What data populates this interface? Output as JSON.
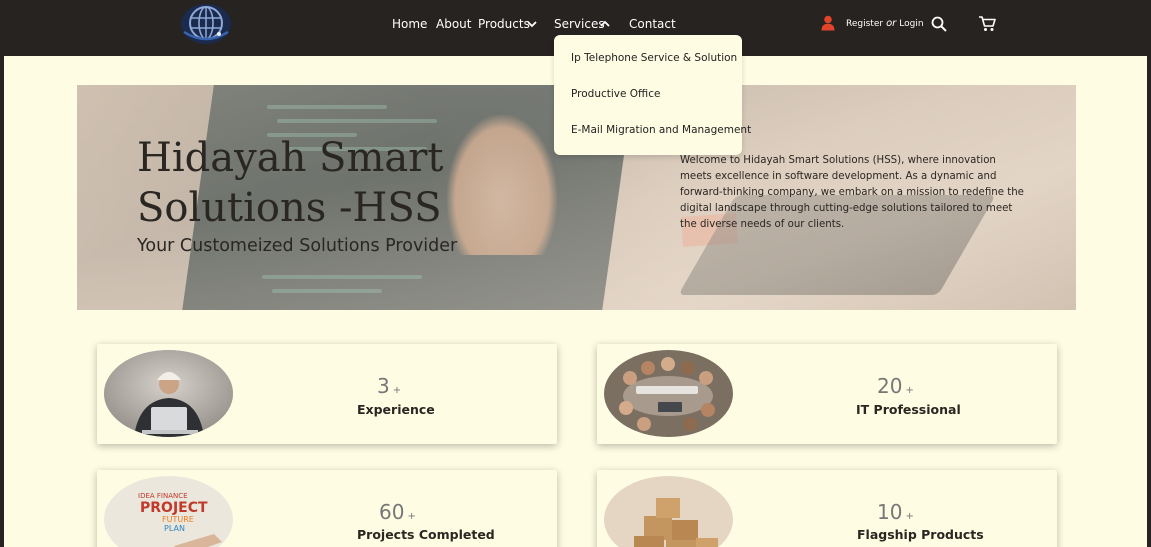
{
  "nav": {
    "home": "Home",
    "about": "About",
    "products": "Products",
    "services": "Services",
    "contact": "Contact",
    "register": "Register",
    "or": "or",
    "login": "Login"
  },
  "services_menu": {
    "items": [
      "Ip Telephone Service & Solution",
      "Productive Office",
      "E-Mail Migration and Management"
    ]
  },
  "hero": {
    "title": "Hidayah Smart Solutions -HSS",
    "subtitle": "Your Customeized Solutions Provider",
    "description": "Welcome to Hidayah Smart Solutions (HSS), where innovation meets excellence in software development. As a dynamic and forward-thinking company, we embark on a mission to redefine the digital landscape through cutting-edge solutions tailored to meet the diverse needs of our clients."
  },
  "stats": [
    {
      "value": "3",
      "plus": "+",
      "label": "Experience"
    },
    {
      "value": "20",
      "plus": "+",
      "label": "IT Professional"
    },
    {
      "value": "60",
      "plus": "+",
      "label": "Projects Completed"
    },
    {
      "value": "10",
      "plus": "+",
      "label": "Flagship Products"
    }
  ],
  "card_photo_text": {
    "project_lines": [
      "IDEA FINANCE",
      "PROJECT",
      "FUTURE",
      "PLAN"
    ]
  },
  "colors": {
    "nav_bg": "#262321",
    "page_bg": "#fefde3",
    "accent_user": "#e0442a",
    "text_dark": "#2a2622"
  },
  "icons": {
    "logo": "globe-logo",
    "user": "user-icon",
    "search": "search-icon",
    "cart": "cart-icon",
    "products_chevron": "chevron-down-icon",
    "services_chevron": "chevron-up-icon"
  }
}
